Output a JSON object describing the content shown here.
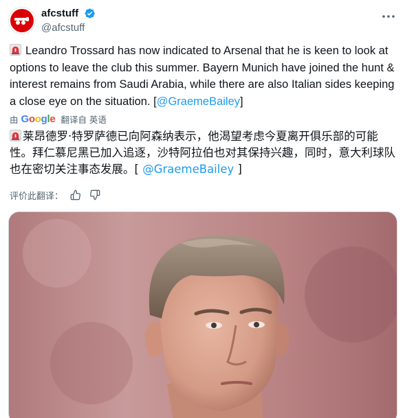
{
  "author": {
    "display_name": "afcstuff",
    "handle": "@afcstuff"
  },
  "tweet": {
    "text_parts": [
      "Leandro Trossard has now indicated to Arsenal that he is keen to look at options to leave the club this summer. Bayern Munich have joined the hunt & interest remains from Saudi Arabia, while there are also Italian sides keeping a close eye on the situation. [",
      "@GraemeBailey",
      "]"
    ]
  },
  "translation": {
    "by_label": "由",
    "provider": "Google",
    "label": "翻译自 英语",
    "text_parts": [
      "莱昂德罗·特罗萨德已向阿森纳表示，他渴望考虑今夏离开俱乐部的可能性。拜仁慕尼黑已加入追逐，沙特阿拉伯也对其保持兴趣，同时，意大利球队也在密切关注事态发展。[ ",
      "@GraemeBailey",
      " ]"
    ],
    "rate_label": "评价此翻译："
  },
  "colors": {
    "accent": "#1d9bf0",
    "secondary_text": "#536471",
    "arsenal_red": "#db0007"
  },
  "icons": {
    "verified": "verified-badge-icon",
    "more": "more-horizontal-icon",
    "siren": "rotating-light-emoji",
    "thumbs_up": "thumbs-up-icon",
    "thumbs_down": "thumbs-down-icon"
  }
}
